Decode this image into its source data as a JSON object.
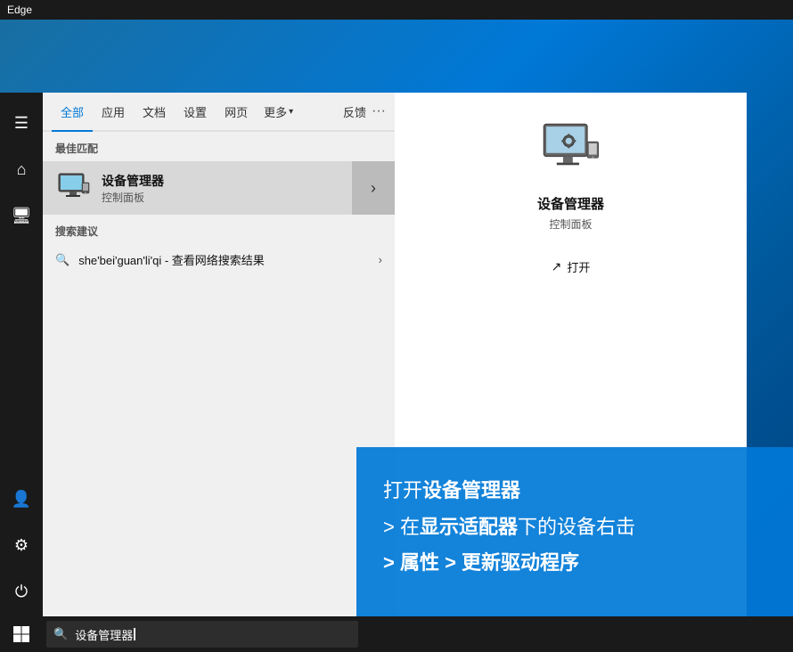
{
  "titlebar": {
    "title": "Edge"
  },
  "desktop": {
    "background": "#0078d7"
  },
  "taskbar": {
    "search_placeholder": "设备管理器",
    "search_value": "设备管理器",
    "search_icon": "🔍"
  },
  "start_menu": {
    "tabs": [
      {
        "id": "all",
        "label": "全部",
        "active": true
      },
      {
        "id": "apps",
        "label": "应用"
      },
      {
        "id": "docs",
        "label": "文档"
      },
      {
        "id": "settings",
        "label": "设置"
      },
      {
        "id": "web",
        "label": "网页"
      },
      {
        "id": "more",
        "label": "更多"
      }
    ],
    "feedback_label": "反馈",
    "dots_label": "···",
    "best_match_label": "最佳匹配",
    "best_match_item": {
      "title": "设备管理器",
      "subtitle": "控制面板"
    },
    "suggestion_label": "搜索建议",
    "suggestions": [
      {
        "query": "she'bei'guan'li'qi",
        "action": "查看网络搜索结果"
      }
    ],
    "preview": {
      "title": "设备管理器",
      "subtitle": "控制面板",
      "open_label": "打开"
    }
  },
  "sidebar": {
    "icons": [
      {
        "name": "hamburger-icon",
        "symbol": "☰"
      },
      {
        "name": "home-icon",
        "symbol": "⌂"
      },
      {
        "name": "document-icon",
        "symbol": "📄"
      },
      {
        "name": "user-icon",
        "symbol": "👤"
      },
      {
        "name": "settings-icon",
        "symbol": "⚙"
      },
      {
        "name": "power-icon",
        "symbol": "⏻"
      }
    ]
  },
  "annotation": {
    "line1_prefix": "打开",
    "line1_bold": "设备管理器",
    "line2_prefix": "> 在",
    "line2_bold": "显示适配器",
    "line2_suffix": "下的设备右击",
    "line3": "> 属性 > 更新驱动程序"
  }
}
